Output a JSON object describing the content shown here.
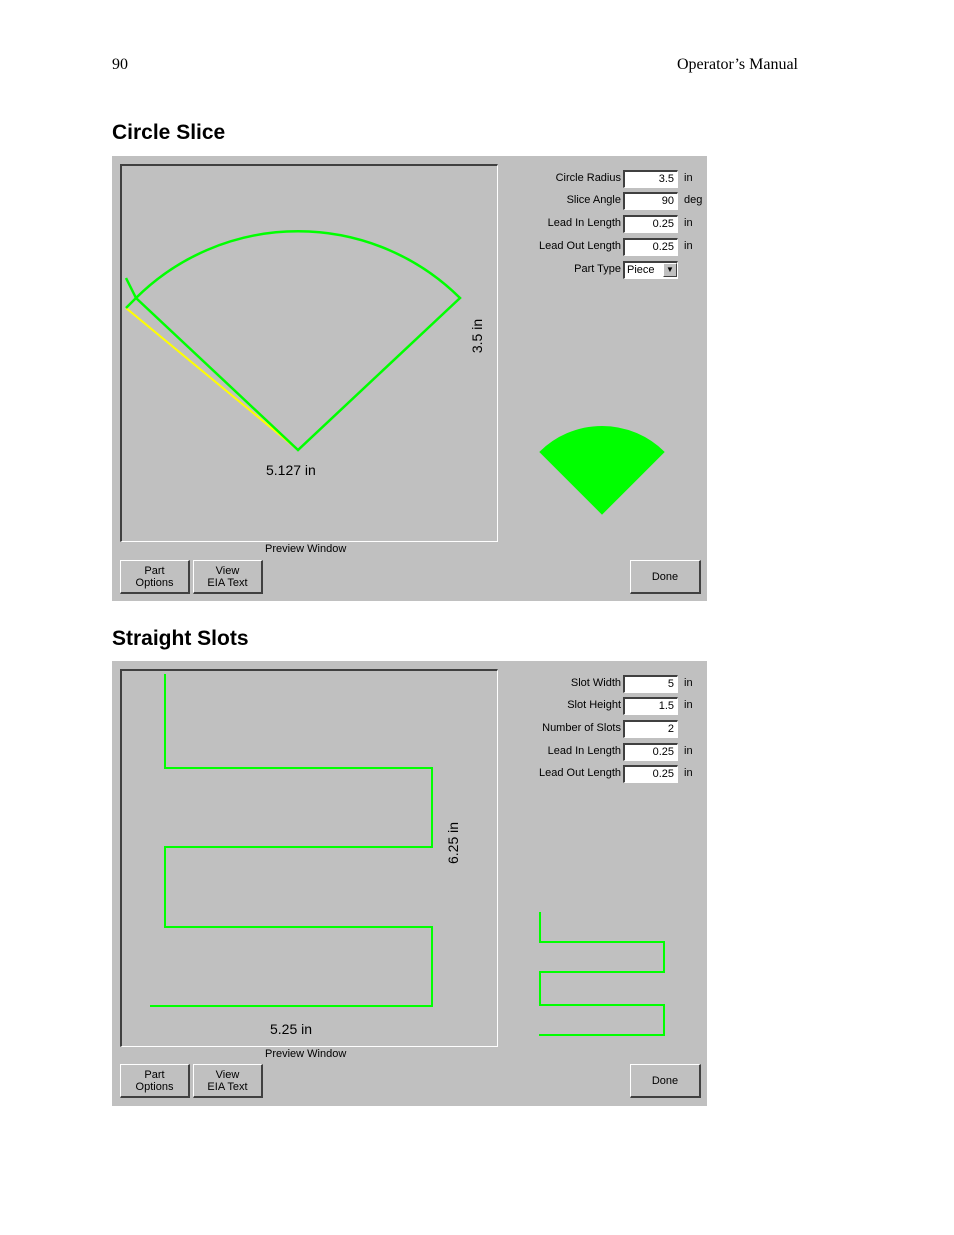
{
  "header": {
    "page_number": "90",
    "manual_title": "Operator’s Manual"
  },
  "circle_slice": {
    "heading": "Circle Slice",
    "params": [
      {
        "label": "Circle Radius",
        "value": "3.5",
        "unit": "in"
      },
      {
        "label": "Slice Angle",
        "value": "90",
        "unit": "deg"
      },
      {
        "label": "Lead In Length",
        "value": "0.25",
        "unit": "in"
      },
      {
        "label": "Lead Out Length",
        "value": "0.25",
        "unit": "in"
      }
    ],
    "part_type": {
      "label": "Part Type",
      "value": "Piece"
    },
    "dim_width": "5.127 in",
    "dim_height": "3.5 in",
    "preview_caption": "Preview Window",
    "buttons": {
      "part_options_1": "Part",
      "part_options_2": "Options",
      "view_eia_1": "View",
      "view_eia_2": "EIA Text",
      "done": "Done"
    }
  },
  "straight_slots": {
    "heading": "Straight Slots",
    "params": [
      {
        "label": "Slot Width",
        "value": "5",
        "unit": "in"
      },
      {
        "label": "Slot Height",
        "value": "1.5",
        "unit": "in"
      },
      {
        "label": "Number of Slots",
        "value": "2",
        "unit": ""
      },
      {
        "label": "Lead In Length",
        "value": "0.25",
        "unit": "in"
      },
      {
        "label": "Lead Out Length",
        "value": "0.25",
        "unit": "in"
      }
    ],
    "dim_width": "5.25 in",
    "dim_height": "6.25 in",
    "preview_caption": "Preview Window",
    "buttons": {
      "part_options_1": "Part",
      "part_options_2": "Options",
      "view_eia_1": "View",
      "view_eia_2": "EIA Text",
      "done": "Done"
    }
  },
  "colors": {
    "path": "#00ff00",
    "lead": "#ffff00",
    "dialog_bg": "#c0c0c0"
  }
}
